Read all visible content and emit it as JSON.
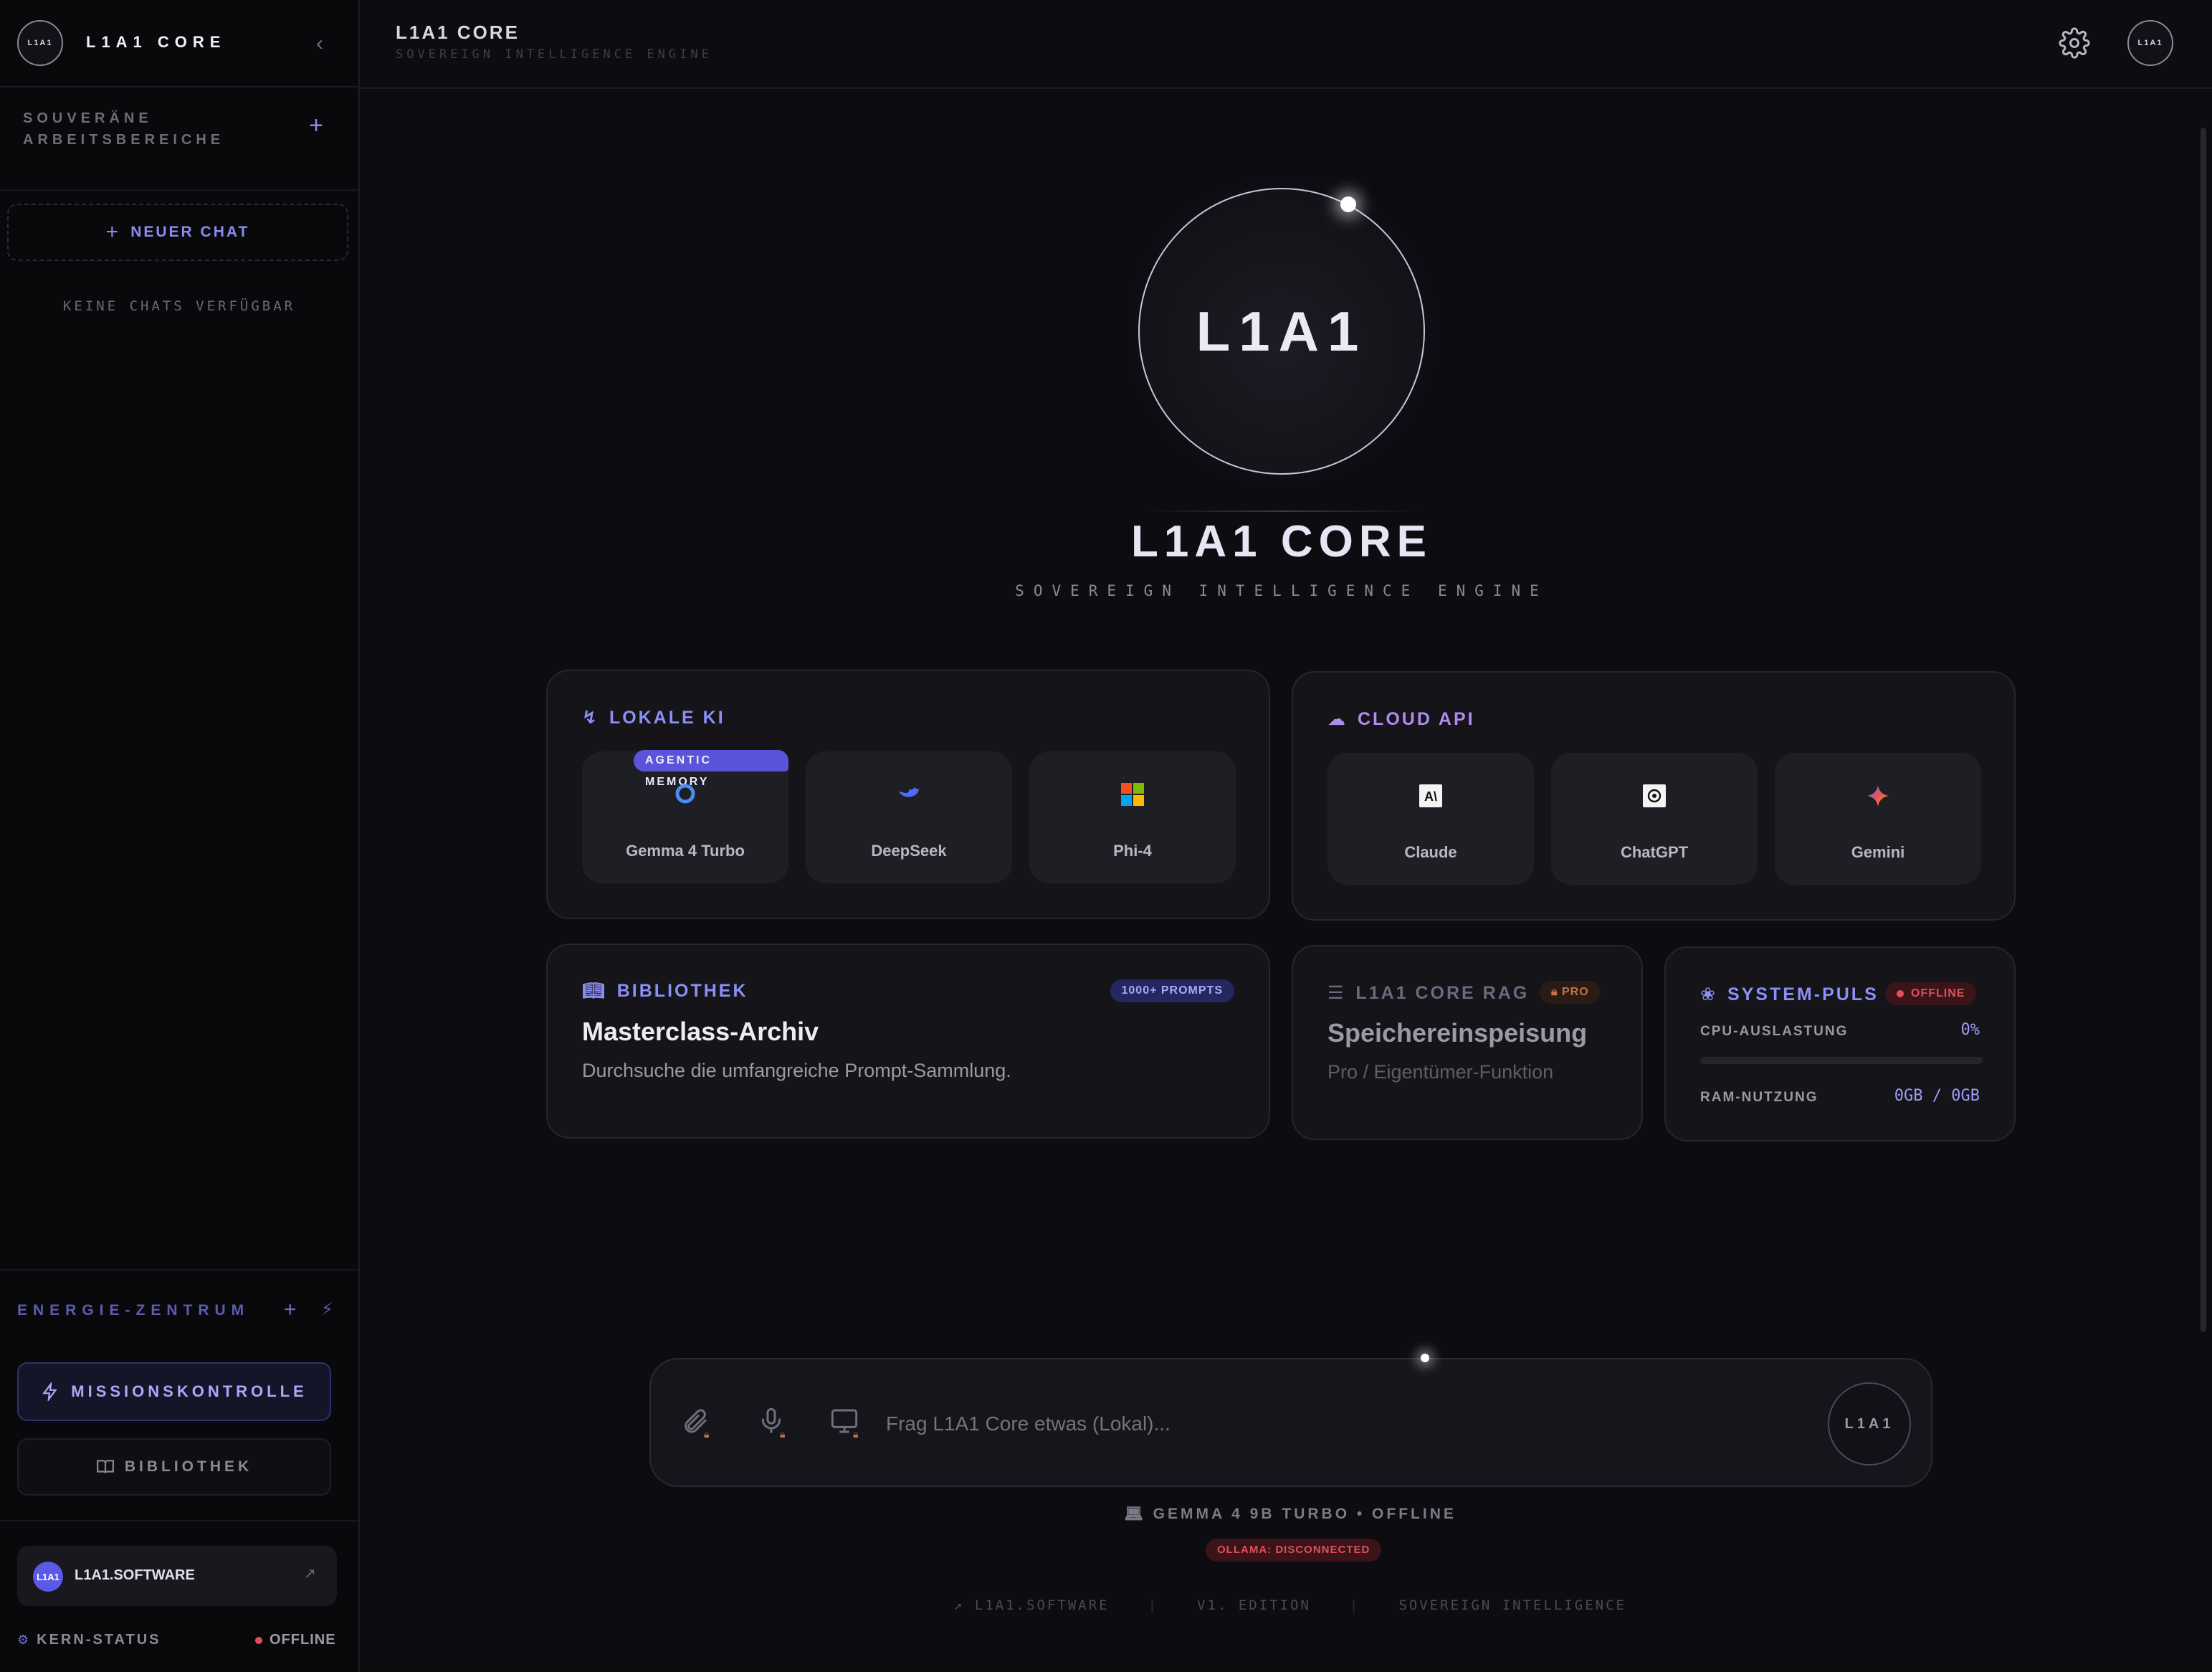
{
  "sidebar": {
    "logo_text": "L1A1",
    "brand": "L1A1 CORE",
    "workspaces_title": "SOUVERÄNE ARBEITSBEREICHE",
    "new_chat_label": "NEUER CHAT",
    "no_chats": "KEINE CHATS VERFÜGBAR",
    "energy_title": "ENERGIE-ZENTRUM",
    "mission_label": "MISSIONSKONTROLLE",
    "library_label": "BIBLIOTHEK",
    "software_badge": "L1A1",
    "software_label": "L1A1.SOFTWARE",
    "kern_label": "KERN-STATUS",
    "kern_status": "OFFLINE"
  },
  "topbar": {
    "title": "L1A1 CORE",
    "subtitle": "SOVEREIGN INTELLIGENCE ENGINE",
    "avatar_text": "L1A1"
  },
  "hero": {
    "orb_text": "L1A1",
    "title": "L1A1 CORE",
    "subtitle": "SOVEREIGN INTELLIGENCE ENGINE"
  },
  "local_ai": {
    "title": "LOKALE KI",
    "badge": "AGENTIC MEMORY",
    "models": [
      "Gemma 4 Turbo",
      "DeepSeek",
      "Phi-4"
    ]
  },
  "cloud_api": {
    "title": "CLOUD API",
    "models": [
      "Claude",
      "ChatGPT",
      "Gemini"
    ]
  },
  "library": {
    "label": "BIBLIOTHEK",
    "badge": "1000+ PROMPTS",
    "title": "Masterclass-Archiv",
    "description": "Durchsuche die umfangreiche Prompt-Sammlung."
  },
  "rag": {
    "label": "L1A1 CORE RAG",
    "badge": "PRO",
    "title": "Speichereinspeisung",
    "description": "Pro / Eigentümer-Funktion"
  },
  "system": {
    "label": "SYSTEM-PULS",
    "status": "OFFLINE",
    "cpu_label": "CPU-AUSLASTUNG",
    "cpu_value": "0%",
    "cpu_fraction": 0,
    "ram_label": "RAM-NUTZUNG",
    "ram_value": "0GB / 0GB"
  },
  "input": {
    "placeholder": "Frag L1A1 Core etwas (Lokal)...",
    "send_text": "L1A1",
    "model_status": "GEMMA 4 9B TURBO • OFFLINE",
    "ollama_status": "OLLAMA: DISCONNECTED"
  },
  "footer": {
    "items": [
      "L1A1.SOFTWARE",
      "V1. EDITION",
      "SOVEREIGN INTELLIGENCE"
    ]
  },
  "colors": {
    "accent": "#8d8ef6",
    "cloud_accent": "#b08cf0",
    "offline_red": "#e0505a",
    "pro_orange": "#c8704a"
  }
}
